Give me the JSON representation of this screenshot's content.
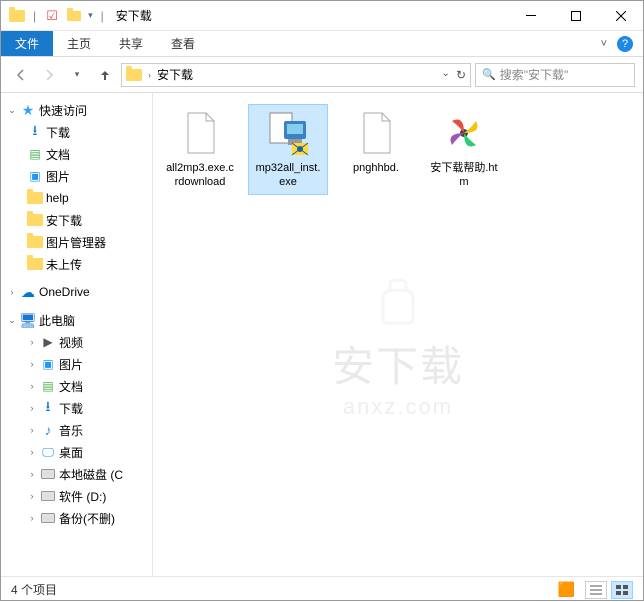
{
  "titlebar": {
    "title": "安下载",
    "separator": "|"
  },
  "ribbon": {
    "tabs": [
      "文件",
      "主页",
      "共享",
      "查看"
    ],
    "expand_tip": "^"
  },
  "addressbar": {
    "crumbs": [
      "安下载"
    ],
    "search_placeholder": "搜索\"安下载\""
  },
  "sidebar": {
    "quick_access": "快速访问",
    "quick_items": [
      {
        "label": "下载",
        "icon": "download"
      },
      {
        "label": "文档",
        "icon": "document"
      },
      {
        "label": "图片",
        "icon": "picture"
      },
      {
        "label": "help",
        "icon": "folder"
      },
      {
        "label": "安下载",
        "icon": "folder"
      },
      {
        "label": "图片管理器",
        "icon": "folder"
      },
      {
        "label": "未上传",
        "icon": "folder"
      }
    ],
    "onedrive": "OneDrive",
    "thispc": "此电脑",
    "pc_items": [
      {
        "label": "视频",
        "icon": "video"
      },
      {
        "label": "图片",
        "icon": "picture"
      },
      {
        "label": "文档",
        "icon": "document"
      },
      {
        "label": "下载",
        "icon": "download"
      },
      {
        "label": "音乐",
        "icon": "music"
      },
      {
        "label": "桌面",
        "icon": "desktop"
      },
      {
        "label": "本地磁盘 (C",
        "icon": "drive"
      },
      {
        "label": "软件 (D:)",
        "icon": "drive"
      },
      {
        "label": "备份(不删)",
        "icon": "drive"
      }
    ]
  },
  "files": [
    {
      "name": "all2mp3.exe.crdownload",
      "type": "blank",
      "selected": false
    },
    {
      "name": "mp32all_inst.exe",
      "type": "installer",
      "selected": true
    },
    {
      "name": "pnghhbd.",
      "type": "blank",
      "selected": false
    },
    {
      "name": "安下载帮助.htm",
      "type": "pinwheel",
      "selected": false
    }
  ],
  "watermark": {
    "main": "安下载",
    "sub": "anxz.com"
  },
  "statusbar": {
    "count": "4 个项目"
  }
}
